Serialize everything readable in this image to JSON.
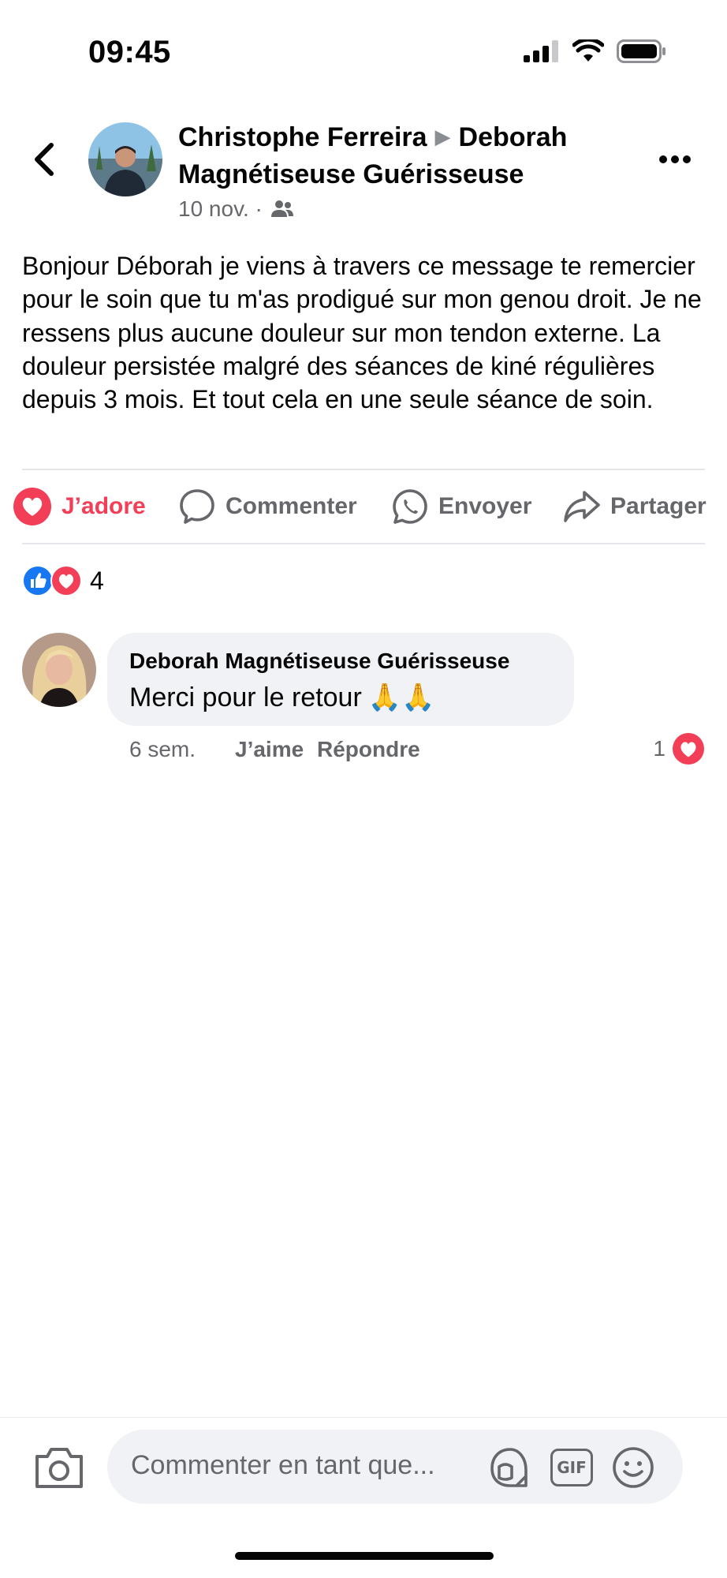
{
  "status_bar": {
    "time": "09:45"
  },
  "post": {
    "author": "Christophe Ferreira",
    "target_page": "Deborah Magnétiseuse Guérisseuse",
    "date": "10 nov. ·",
    "audience_icon": "friends-icon",
    "body": "Bonjour Déborah je viens à travers ce message te remercier pour le soin que tu m'as prodigué sur mon genou droit. Je ne ressens plus aucune douleur sur mon tendon externe. La douleur persistée malgré des séances de kiné régulières depuis 3 mois. Et tout cela en une seule séance de soin."
  },
  "actions": {
    "love_label": "J’adore",
    "comment_label": "Commenter",
    "send_label": "Envoyer",
    "share_label": "Partager"
  },
  "reactions": {
    "types": [
      "like",
      "love"
    ],
    "count": "4"
  },
  "comment": {
    "author": "Deborah Magnétiseuse Guérisseuse",
    "text": "Merci pour le retour",
    "emoji": "🙏🙏",
    "time": "6 sem.",
    "like_label": "J’aime",
    "reply_label": "Répondre",
    "reaction_count": "1"
  },
  "composer": {
    "placeholder": "Commenter en tant que...",
    "gif_label": "GIF"
  },
  "colors": {
    "love": "#f33e58",
    "like": "#1877f2",
    "muted": "#65676b",
    "bubble": "#f0f2f5"
  }
}
